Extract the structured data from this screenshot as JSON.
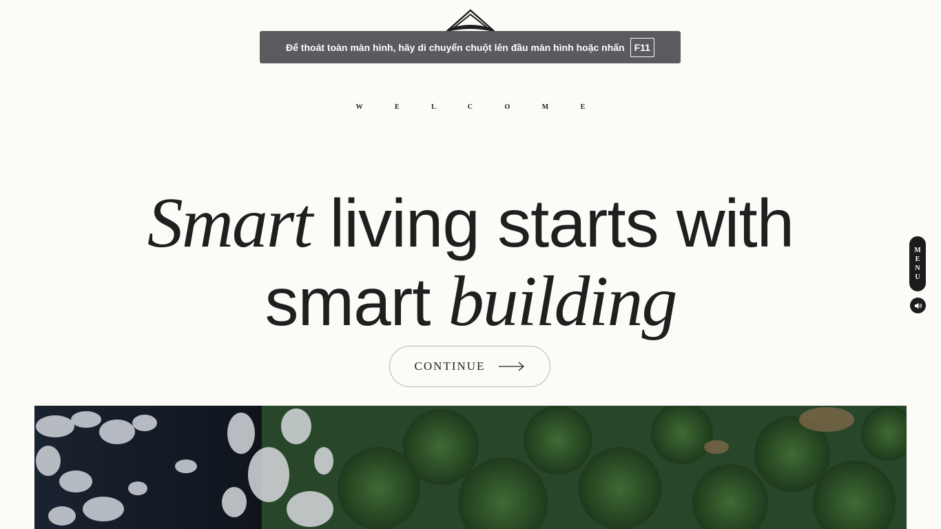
{
  "fullscreen_notice": {
    "message": "Để thoát toàn màn hình, hãy di chuyển chuột lên đầu màn hình hoặc nhấn",
    "key": "F11"
  },
  "hero": {
    "eyebrow": "W E L C O M E",
    "line1_italic": "Smart",
    "line1_rest": " living starts with",
    "line2_start": "smart ",
    "line2_italic": "building",
    "cta_label": "CONTINUE"
  },
  "side_menu": {
    "letters": [
      "M",
      "E",
      "N",
      "U"
    ]
  },
  "icons": {
    "logo": "roof-logo-icon",
    "cta": "arrow-right-icon",
    "sound": "speaker-icon"
  },
  "colors": {
    "background": "#fdfbf7",
    "text": "#1f1f1f",
    "toast": "#5a5b5f",
    "pill": "#1c1c1c"
  }
}
